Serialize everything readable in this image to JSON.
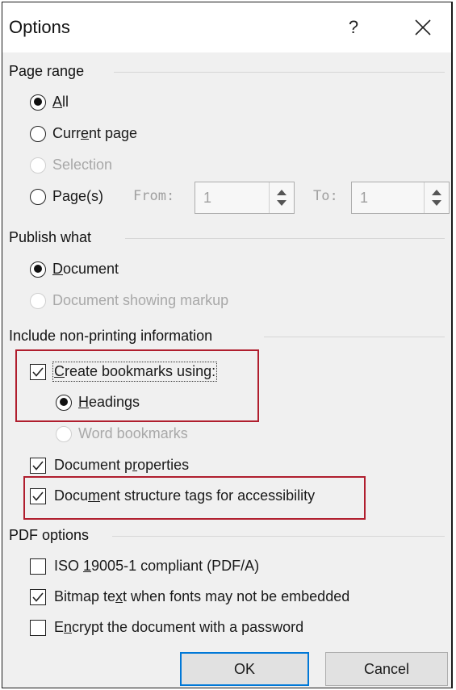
{
  "dialog": {
    "title": "Options",
    "help": "?"
  },
  "page_range": {
    "label": "Page range",
    "all": {
      "pre": "",
      "key": "A",
      "post": "ll"
    },
    "current_page": {
      "pre": "Curr",
      "key": "e",
      "post": "nt page"
    },
    "selection": "Selection",
    "pages": {
      "pre": "Pa",
      "key": "g",
      "post": "e(s)"
    },
    "from_label": "From:",
    "from_value": "1",
    "to_label": "To:",
    "to_value": "1"
  },
  "publish_what": {
    "label": "Publish what",
    "document": {
      "pre": "",
      "key": "D",
      "post": "ocument"
    },
    "document_markup": "Document showing markup"
  },
  "non_printing": {
    "label": "Include non-printing information",
    "create_bookmarks": {
      "pre": "",
      "key": "C",
      "post": "reate bookmarks using:",
      "checked": true
    },
    "headings": {
      "pre": "",
      "key": "H",
      "post": "eadings"
    },
    "word_bookmarks": "Word bookmarks",
    "doc_properties": {
      "pre": "Document p",
      "key": "r",
      "post": "operties",
      "checked": true
    },
    "structure_tags": {
      "pre": "Docu",
      "key": "m",
      "post": "ent structure tags for accessibility",
      "checked": true
    }
  },
  "pdf_options": {
    "label": "PDF options",
    "iso": {
      "pre": "ISO ",
      "key": "1",
      "post": "9005-1 compliant (PDF/A)",
      "checked": false
    },
    "bitmap": {
      "pre": "Bitmap te",
      "key": "x",
      "post": "t when fonts may not be embedded",
      "checked": true
    },
    "encrypt": {
      "pre": "E",
      "key": "n",
      "post": "crypt the document with a password",
      "checked": false
    }
  },
  "buttons": {
    "ok": "OK",
    "cancel": "Cancel"
  },
  "colors": {
    "highlight": "#b01e2e",
    "default_button_border": "#0078d7"
  }
}
